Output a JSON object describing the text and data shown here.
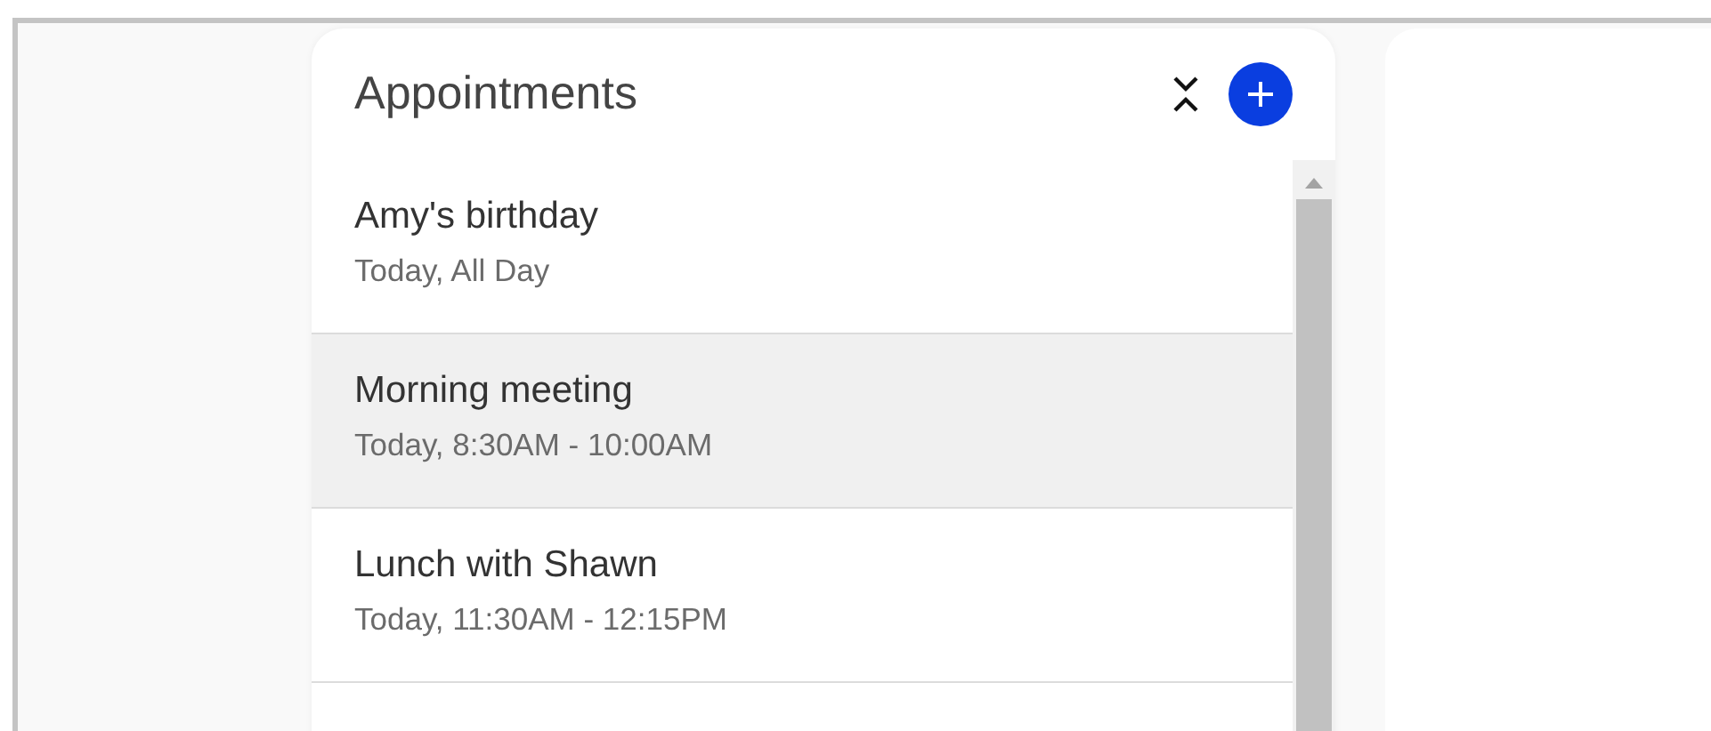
{
  "panel": {
    "title": "Appointments"
  },
  "appointments": [
    {
      "title": "Amy's birthday",
      "time": "Today, All Day",
      "selected": false
    },
    {
      "title": "Morning meeting",
      "time": "Today, 8:30AM - 10:00AM",
      "selected": true
    },
    {
      "title": "Lunch with Shawn",
      "time": "Today, 11:30AM - 12:15PM",
      "selected": false
    }
  ]
}
